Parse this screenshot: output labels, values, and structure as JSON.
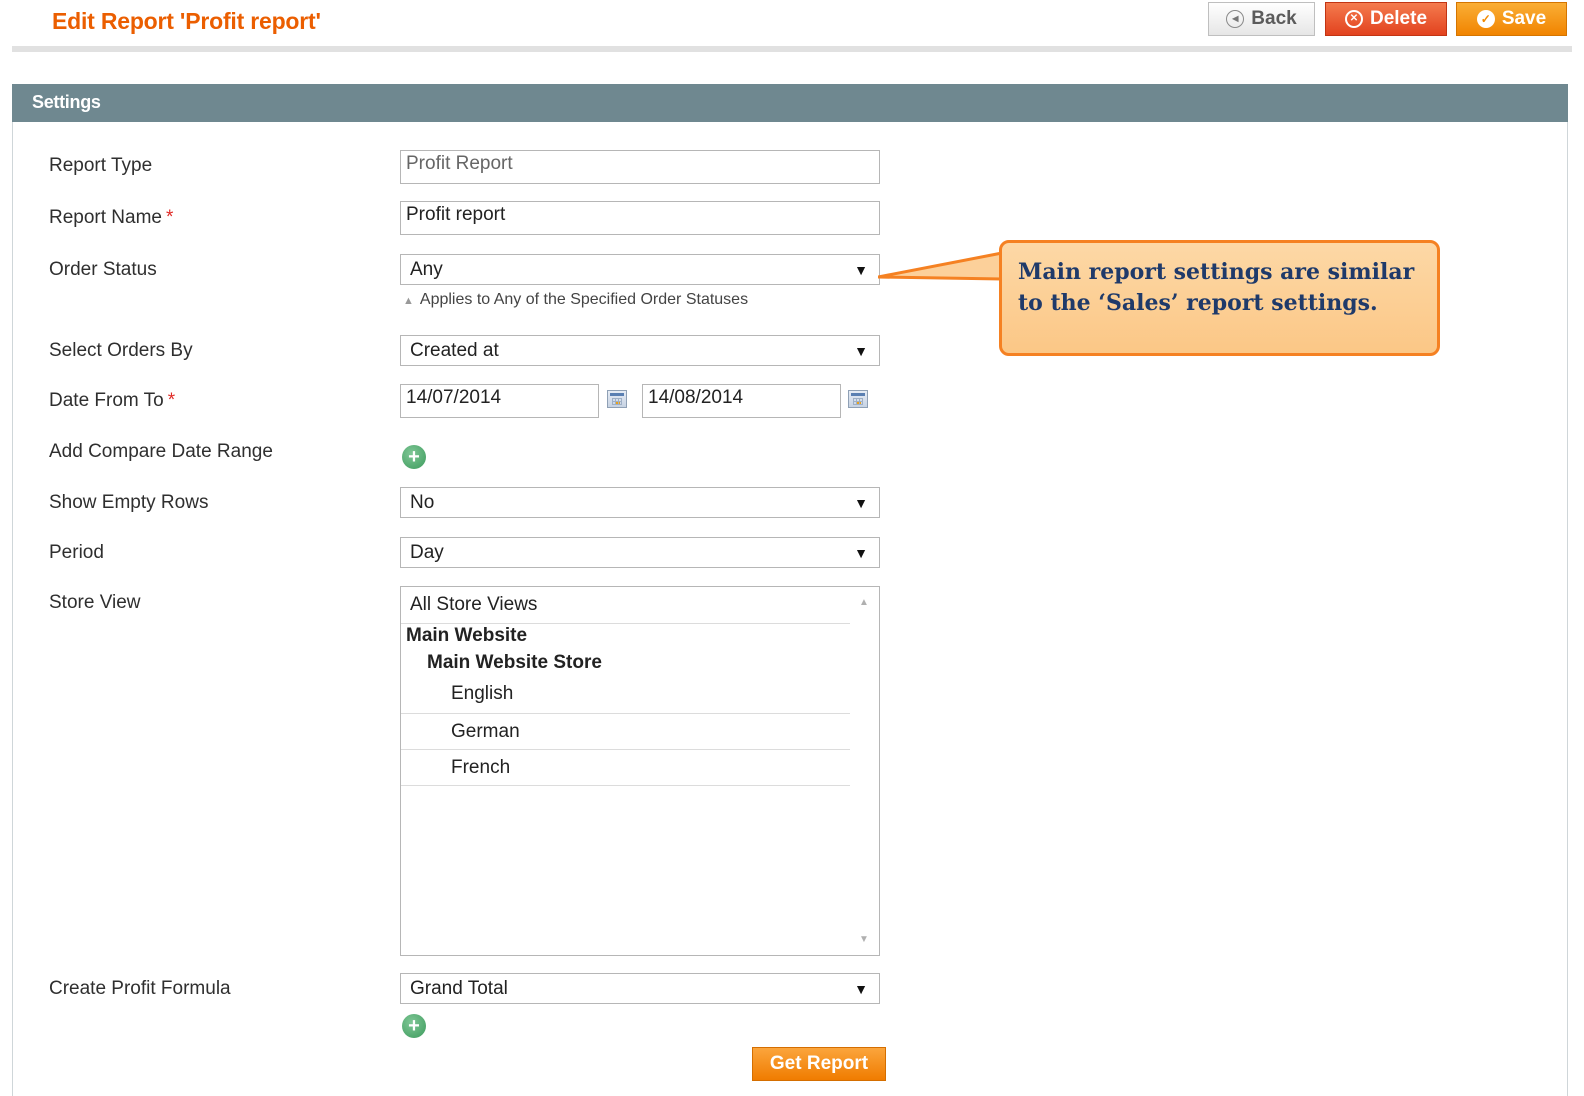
{
  "header": {
    "title": "Edit Report 'Profit report'",
    "buttons": {
      "back": "Back",
      "delete": "Delete",
      "save": "Save"
    }
  },
  "panel": {
    "title": "Settings"
  },
  "form": {
    "report_type": {
      "label": "Report Type",
      "value": "Profit Report"
    },
    "report_name": {
      "label": "Report Name",
      "required_mark": "*",
      "value": "Profit report"
    },
    "order_status": {
      "label": "Order Status",
      "value": "Any",
      "note": "Applies to Any of the Specified Order Statuses"
    },
    "select_orders_by": {
      "label": "Select Orders By",
      "value": "Created at"
    },
    "date_range": {
      "label": "Date From To",
      "required_mark": "*",
      "from": "14/07/2014",
      "to": "14/08/2014"
    },
    "compare_range": {
      "label": "Add Compare Date Range"
    },
    "show_empty_rows": {
      "label": "Show Empty Rows",
      "value": "No"
    },
    "period": {
      "label": "Period",
      "value": "Day"
    },
    "store_view": {
      "label": "Store View",
      "options": [
        {
          "text": "All Store Views",
          "level": 0,
          "group": false
        },
        {
          "text": "Main Website",
          "level": 0,
          "group": true
        },
        {
          "text": "Main Website Store",
          "level": 1,
          "group": true
        },
        {
          "text": "English",
          "level": 2,
          "group": false
        },
        {
          "text": "German",
          "level": 2,
          "group": false
        },
        {
          "text": "French",
          "level": 2,
          "group": false
        }
      ]
    },
    "profit_formula": {
      "label": "Create Profit Formula",
      "value": "Grand Total"
    },
    "submit_label": "Get Report"
  },
  "callout": {
    "text": "Main report settings are similar to the ‘Sales’ report settings."
  },
  "icons": {
    "back": "circle-left-arrow-icon",
    "delete": "circle-x-icon",
    "save": "check-circle-icon",
    "calendar": "calendar-icon",
    "add": "plus-circle-icon",
    "dropdown": "chevron-down-icon"
  },
  "colors": {
    "title": "#eb5e00",
    "panel_header": "#6f8890",
    "delete_button": "#e2421e",
    "save_button": "#f18400",
    "callout_border": "#f58122",
    "callout_fill": "#fcd09a",
    "callout_text": "#1f3a6a"
  }
}
